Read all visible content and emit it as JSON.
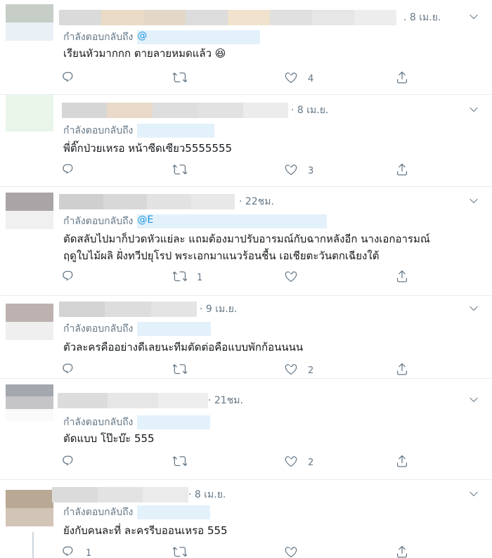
{
  "reply_prefix": "กำลังตอบกลับถึง",
  "colors": {
    "muted": "#657786",
    "link": "#1b95e0",
    "divider": "#e6ecf0",
    "text": "#14171a"
  },
  "icons": [
    "reply-icon",
    "retweet-icon",
    "like-icon",
    "share-icon",
    "chevron-down-icon"
  ],
  "tweets": [
    {
      "time": ". 8 เม.ย.",
      "mention": "@",
      "body": [
        "เรียนหัวมากกก ตายลายหมดแล้ว 😆"
      ],
      "reply_count": "",
      "retweet_count": "",
      "like_count": "4"
    },
    {
      "time": "· 8 เม.ย.",
      "mention": "",
      "body": [
        "พี่ติ๊กป่วยเหรอ หน้าซีดเซียว5555555"
      ],
      "reply_count": "",
      "retweet_count": "",
      "like_count": "3"
    },
    {
      "time": "· 22ชม.",
      "mention": "@E",
      "body": [
        "ตัดสลับไปมาก็ปวดหัวแย่ละ แถมต้องมาปรับอารมณ์กับฉากหลังอีก นางเอกอารมณ์",
        "ฤดูใบไม้ผลิ ฝั่งทวีปยุโรป พระเอกมาแนวร้อนชื้น เอเชียตะวันตกเฉียงใต้"
      ],
      "reply_count": "",
      "retweet_count": "1",
      "like_count": ""
    },
    {
      "time": "· 9 เม.ย.",
      "mention": "",
      "body": [
        "ตัวละครคืออย่างดีเลยนะทีมตัดต่อคือแบบพักก้อนนนน"
      ],
      "reply_count": "",
      "retweet_count": "",
      "like_count": "2"
    },
    {
      "time": "· 21ชม.",
      "mention": "",
      "body": [
        "ตัดแบบ โป๊ะบ๊ะ 555"
      ],
      "reply_count": "",
      "retweet_count": "",
      "like_count": "2"
    },
    {
      "time": "· 8 เม.ย.",
      "mention": "",
      "body": [
        "ยังกับคนละที่ ละครรีบออนเหรอ 555"
      ],
      "reply_count": "1",
      "retweet_count": "",
      "like_count": ""
    }
  ]
}
